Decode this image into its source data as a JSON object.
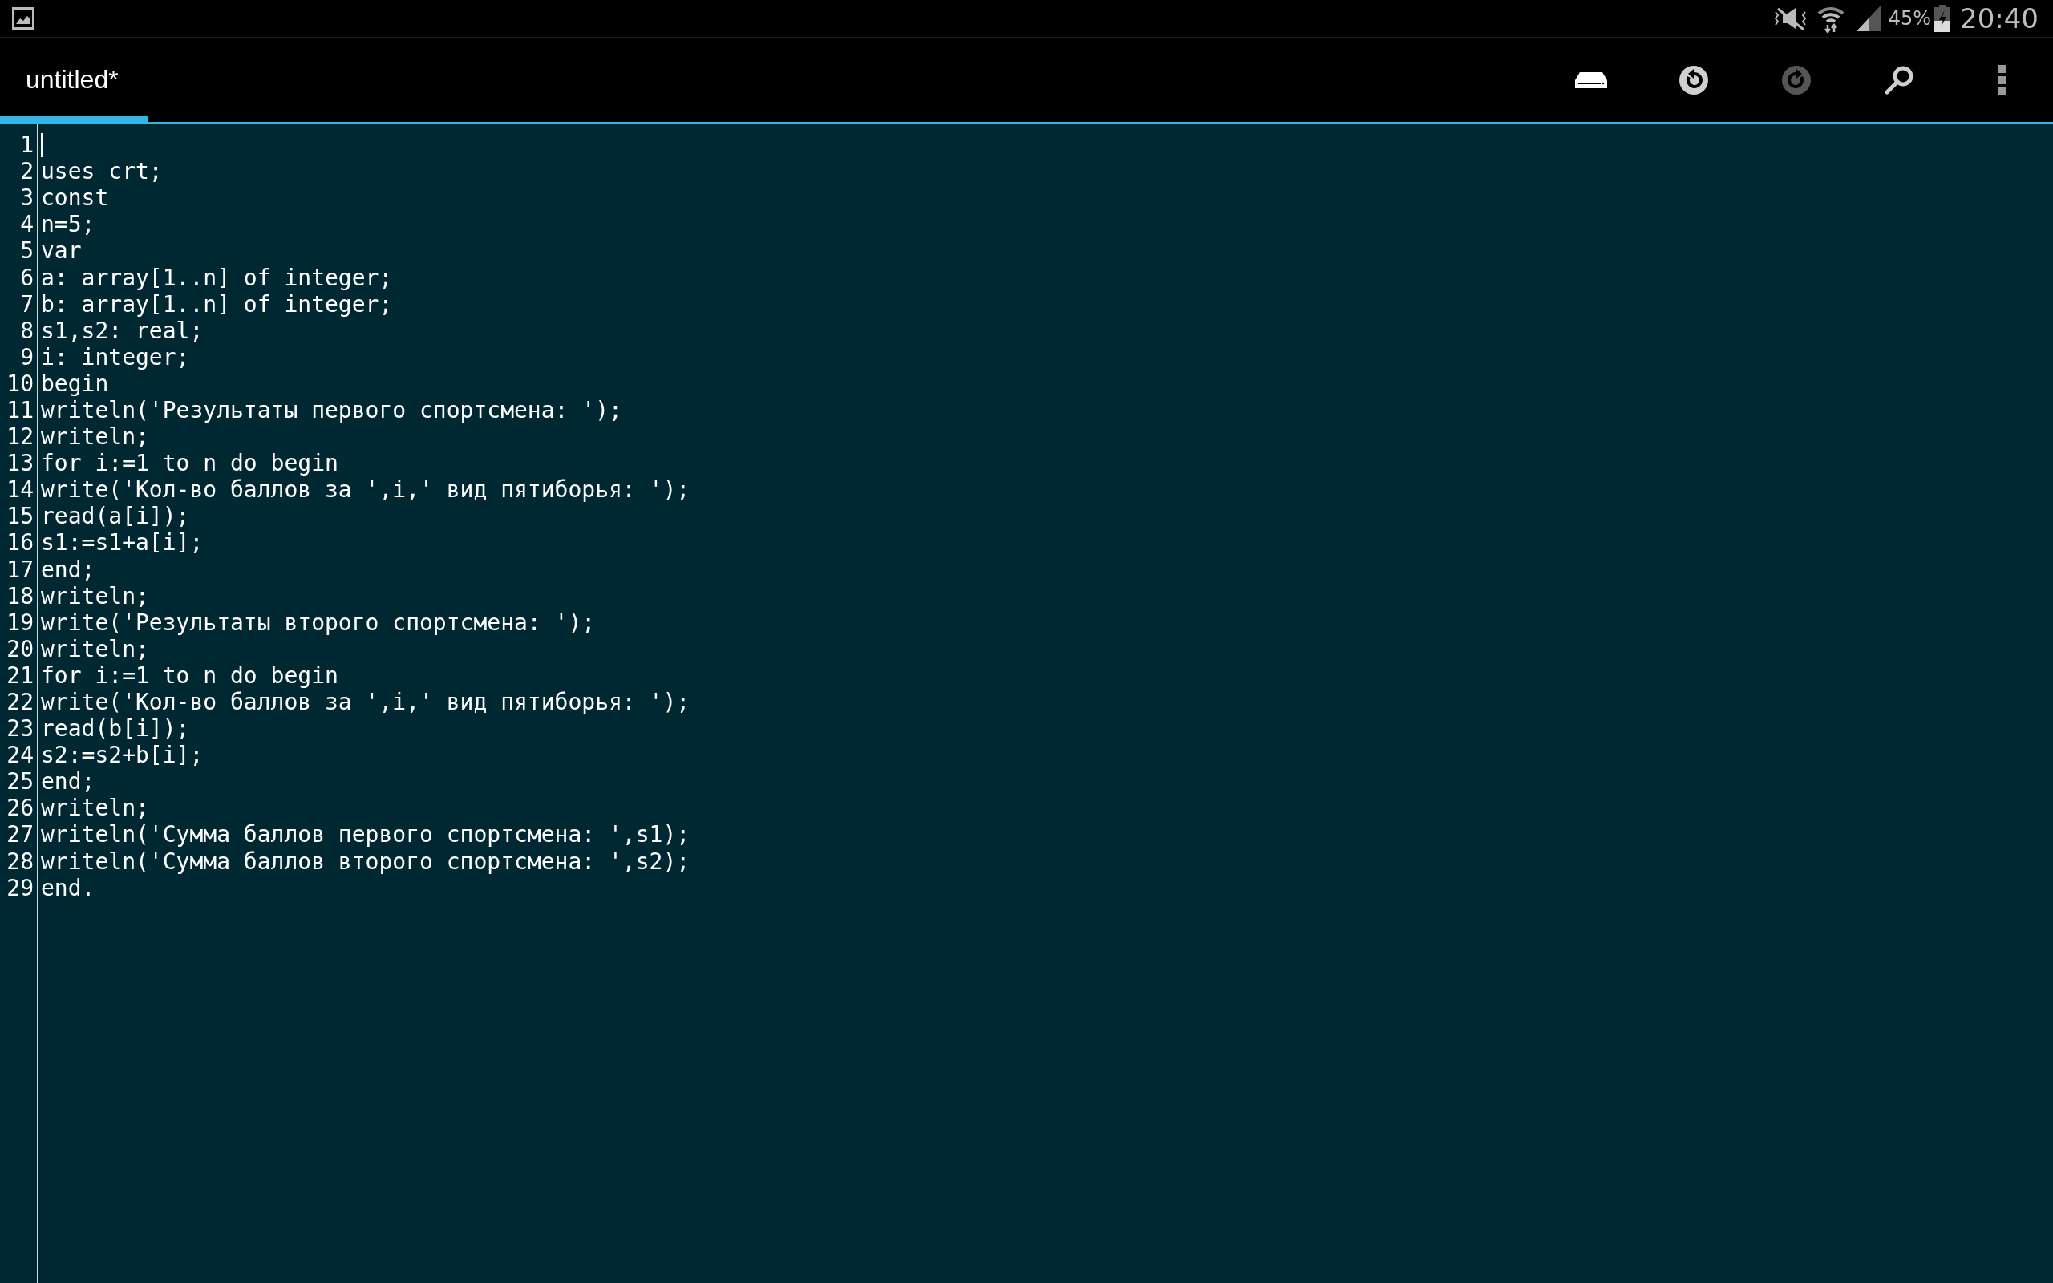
{
  "status_bar": {
    "battery_percent": "45%",
    "time": "20:40"
  },
  "action_bar": {
    "tab": {
      "label": "untitled*",
      "selected": true
    },
    "actions": [
      {
        "kind": "save",
        "disabled": false
      },
      {
        "kind": "undo",
        "disabled": false
      },
      {
        "kind": "redo",
        "disabled": true
      },
      {
        "kind": "search",
        "disabled": false
      },
      {
        "kind": "overflow",
        "disabled": false
      }
    ]
  },
  "editor": {
    "lines": [
      {
        "number": "1",
        "cursor": true
      },
      {
        "number": "2",
        "text": "uses crt;",
        "cursor": false
      },
      {
        "number": "3",
        "text": "const",
        "cursor": false
      },
      {
        "number": "4",
        "text": "n=5;",
        "cursor": false
      },
      {
        "number": "5",
        "text": "var",
        "cursor": false
      },
      {
        "number": "6",
        "text": "a: array[1..n] of integer;",
        "cursor": false
      },
      {
        "number": "7",
        "text": "b: array[1..n] of integer;",
        "cursor": false
      },
      {
        "number": "8",
        "text": "s1,s2: real;",
        "cursor": false
      },
      {
        "number": "9",
        "text": "i: integer;",
        "cursor": false
      },
      {
        "number": "10",
        "text": "begin",
        "cursor": false
      },
      {
        "number": "11",
        "text": "writeln('Результаты первого спортсмена: ');",
        "cursor": false
      },
      {
        "number": "12",
        "text": "writeln;",
        "cursor": false
      },
      {
        "number": "13",
        "text": "for i:=1 to n do begin",
        "cursor": false
      },
      {
        "number": "14",
        "text": "write('Кол-во баллов за ',i,' вид пятиборья: ');",
        "cursor": false
      },
      {
        "number": "15",
        "text": "read(a[i]);",
        "cursor": false
      },
      {
        "number": "16",
        "text": "s1:=s1+a[i];",
        "cursor": false
      },
      {
        "number": "17",
        "text": "end;",
        "cursor": false
      },
      {
        "number": "18",
        "text": "writeln;",
        "cursor": false
      },
      {
        "number": "19",
        "text": "write('Результаты второго спортсмена: ');",
        "cursor": false
      },
      {
        "number": "20",
        "text": "writeln;",
        "cursor": false
      },
      {
        "number": "21",
        "text": "for i:=1 to n do begin",
        "cursor": false
      },
      {
        "number": "22",
        "text": "write('Кол-во баллов за ',i,' вид пятиборья: ');",
        "cursor": false
      },
      {
        "number": "23",
        "text": "read(b[i]);",
        "cursor": false
      },
      {
        "number": "24",
        "text": "s2:=s2+b[i];",
        "cursor": false
      },
      {
        "number": "25",
        "text": "end;",
        "cursor": false
      },
      {
        "number": "26",
        "text": "writeln;",
        "cursor": false
      },
      {
        "number": "27",
        "text": "writeln('Сумма баллов первого спортсмена: ',s1);",
        "cursor": false
      },
      {
        "number": "28",
        "text": "writeln('Сумма баллов второго спортсмена: ',s2);",
        "cursor": false
      },
      {
        "number": "29",
        "text": "end.",
        "cursor": false
      }
    ]
  }
}
